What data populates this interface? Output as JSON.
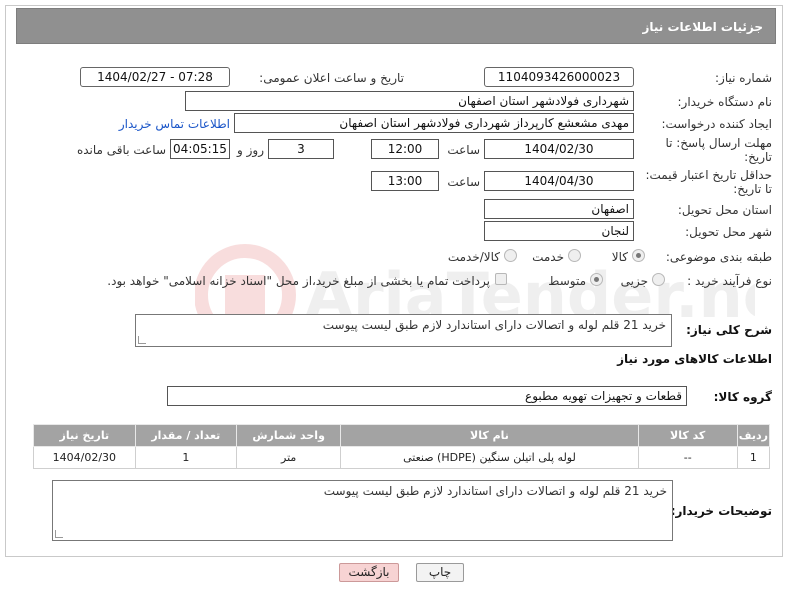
{
  "header": {
    "title": "جزئیات اطلاعات نیاز"
  },
  "fields": {
    "need_number_label": "شماره نیاز:",
    "need_number": "1104093426000023",
    "announce_label": "تاریخ و ساعت اعلان عمومی:",
    "announce_value": "1404/02/27 - 07:28",
    "buyer_org_label": "نام دستگاه خریدار:",
    "buyer_org": "شهرداری فولادشهر استان اصفهان",
    "creator_label": "ایجاد کننده درخواست:",
    "creator": "مهدی مشعشع کارپرداز شهرداری فولادشهر استان اصفهان",
    "contact_link": "اطلاعات تماس خریدار",
    "deadline_label_1": "مهلت ارسال پاسخ: تا",
    "deadline_label_2": "تاریخ:",
    "deadline_date": "1404/02/30",
    "time_label": "ساعت",
    "deadline_time": "12:00",
    "days_value": "3",
    "days_label": "روز و",
    "remaining_time": "04:05:15",
    "remaining_label": "ساعت باقی مانده",
    "validity_label_1": "حداقل تاریخ اعتبار قیمت:",
    "validity_label_2": "تا تاریخ:",
    "validity_date": "1404/04/30",
    "validity_time_label": "ساعت",
    "validity_time": "13:00",
    "province_label": "استان محل تحویل:",
    "province": "اصفهان",
    "city_label": "شهر محل تحویل:",
    "city": "لنجان",
    "category_label": "طبقه بندی موضوعی:",
    "category_options": [
      "کالا",
      "خدمت",
      "کالا/خدمت"
    ],
    "category_selected": "کالا",
    "process_label": "نوع فرآیند خرید :",
    "process_options": [
      "جزیی",
      "متوسط"
    ],
    "process_selected": "متوسط",
    "payment_note": "پرداخت تمام یا بخشی از مبلغ خرید،از محل \"اسناد خزانه اسلامی\" خواهد بود."
  },
  "description": {
    "label": "شرح کلی نیاز:",
    "text": "خرید 21 قلم لوله و اتصالات دارای استاندارد لازم طبق لیست پیوست"
  },
  "goods": {
    "section_title": "اطلاعات کالاهای مورد نیاز",
    "group_label": "گروه کالا:",
    "group_value": "قطعات و تجهیزات تهویه مطبوع",
    "columns": [
      "ردیف",
      "کد کالا",
      "نام کالا",
      "واحد شمارش",
      "تعداد / مقدار",
      "تاریخ نیاز"
    ],
    "rows": [
      [
        "1",
        "--",
        "لوله پلی اتیلن سنگین (HDPE) صنعتی",
        "متر",
        "1",
        "1404/02/30"
      ]
    ]
  },
  "buyer_notes": {
    "label": "توضیحات خریدار:",
    "text": "خرید 21 قلم لوله و اتصالات دارای استاندارد لازم طبق لیست پیوست"
  },
  "buttons": {
    "print": "چاپ",
    "back": "بازگشت"
  },
  "watermark": {
    "text": "AriaTender.net"
  },
  "colors": {
    "header_bg": "#909090",
    "table_header_bg": "#a3a3a3",
    "link": "#1a55c8",
    "back_button": "#f7d3d3"
  }
}
